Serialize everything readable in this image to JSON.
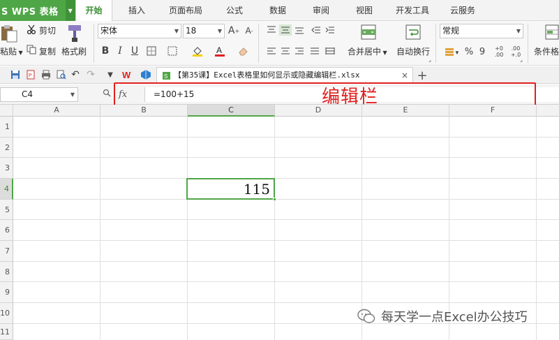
{
  "app": {
    "title": "S WPS 表格",
    "brand_color": "#4fa646"
  },
  "menu": {
    "tabs": [
      "开始",
      "插入",
      "页面布局",
      "公式",
      "数据",
      "审阅",
      "视图",
      "开发工具",
      "云服务"
    ],
    "active_tab": "开始"
  },
  "ribbon": {
    "paste_label": "粘贴",
    "cut_label": "剪切",
    "copy_label": "复制",
    "format_painter_label": "格式刷",
    "font_name": "宋体",
    "font_size": "18",
    "merge_center_label": "合并居中",
    "wrap_text_label": "自动换行",
    "number_format": "常规",
    "conditional_format_label": "条件格",
    "percent_symbol": "%",
    "comma_symbol": "9"
  },
  "quick_access": {
    "doc_tab_title": "【第35课】Excel表格里如何显示或隐藏编辑栏.xlsx",
    "close_symbol": "×",
    "new_tab_symbol": "+"
  },
  "formula_bar": {
    "name_box": "C4",
    "fx_label": "fx",
    "formula": "=100+15"
  },
  "annotation": {
    "label": "编辑栏",
    "color": "#e0201e"
  },
  "sheet": {
    "columns": [
      "A",
      "B",
      "C",
      "D",
      "E",
      "F"
    ],
    "rows": [
      "1",
      "2",
      "3",
      "4",
      "5",
      "6",
      "7",
      "8",
      "9",
      "10",
      "11"
    ],
    "selected_column": "C",
    "selected_row": "4",
    "active_cell_value": "115"
  },
  "watermark": {
    "text": "每天学一点Excel办公技巧"
  }
}
